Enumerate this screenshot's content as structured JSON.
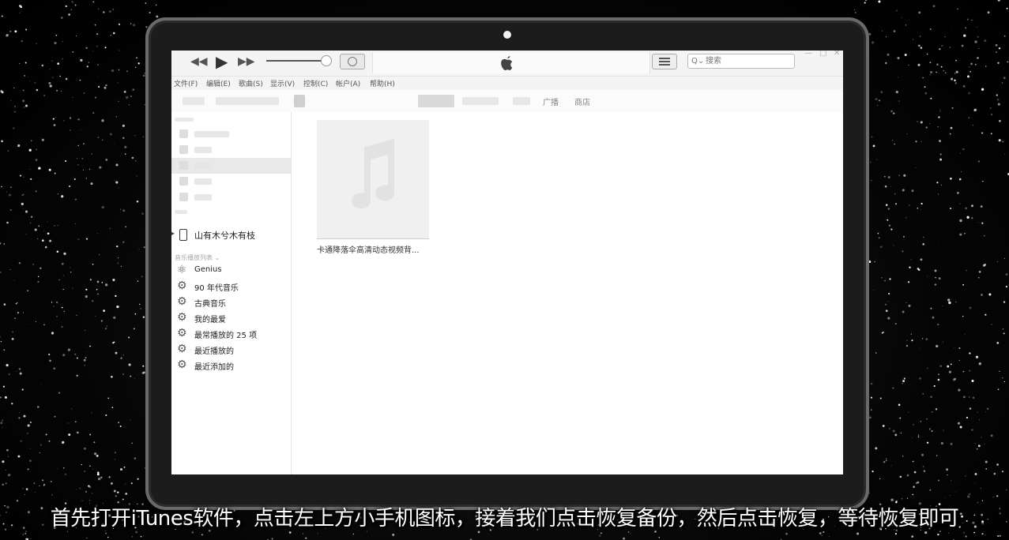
{
  "search": {
    "placeholder": "搜索",
    "icon": "search-icon"
  },
  "menu": [
    "文件(F)",
    "编辑(E)",
    "歌曲(S)",
    "显示(V)",
    "控制(C)",
    "帐户(A)",
    "帮助(H)"
  ],
  "nav": {
    "tabs": [
      "广播",
      "商店"
    ]
  },
  "device": {
    "name": "山有木兮木有枝"
  },
  "playlists": {
    "header": "音乐播放列表 ⌄",
    "items": [
      "Genius",
      "90 年代音乐",
      "古典音乐",
      "我的最爱",
      "最常播放的 25 项",
      "最近播放的",
      "最近添加的"
    ]
  },
  "content": {
    "album_title": "卡通降落伞高清动态视频背..."
  },
  "subtitle": "首先打开iTunes软件，点击左上方小手机图标，接着我们点击恢复备份，然后点击恢复，等待恢复即可",
  "colors": {
    "background": "#000000",
    "screen": "#ffffff",
    "selection": "#e9e9e9"
  }
}
